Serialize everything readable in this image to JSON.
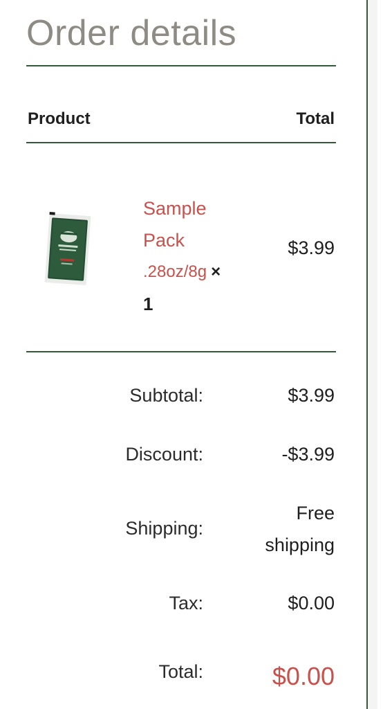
{
  "order": {
    "title": "Order details",
    "columns": {
      "product": "Product",
      "total": "Total"
    },
    "item": {
      "name": "Sample Pack",
      "variant": ".28oz/8g",
      "times": "×",
      "quantity": "1",
      "line_total": "$3.99",
      "thumbnail_icon": "sample-pack-packet"
    },
    "summary": {
      "subtotal_label": "Subtotal:",
      "subtotal_value": "$3.99",
      "discount_label": "Discount:",
      "discount_value": "-$3.99",
      "shipping_label": "Shipping:",
      "shipping_value": "Free shipping",
      "tax_label": "Tax:",
      "tax_value": "$0.00",
      "total_label": "Total:",
      "total_value": "$0.00"
    }
  },
  "colors": {
    "accent_red": "#c9514c",
    "rule_green": "#35573a",
    "title_gray": "#8d8b83"
  }
}
